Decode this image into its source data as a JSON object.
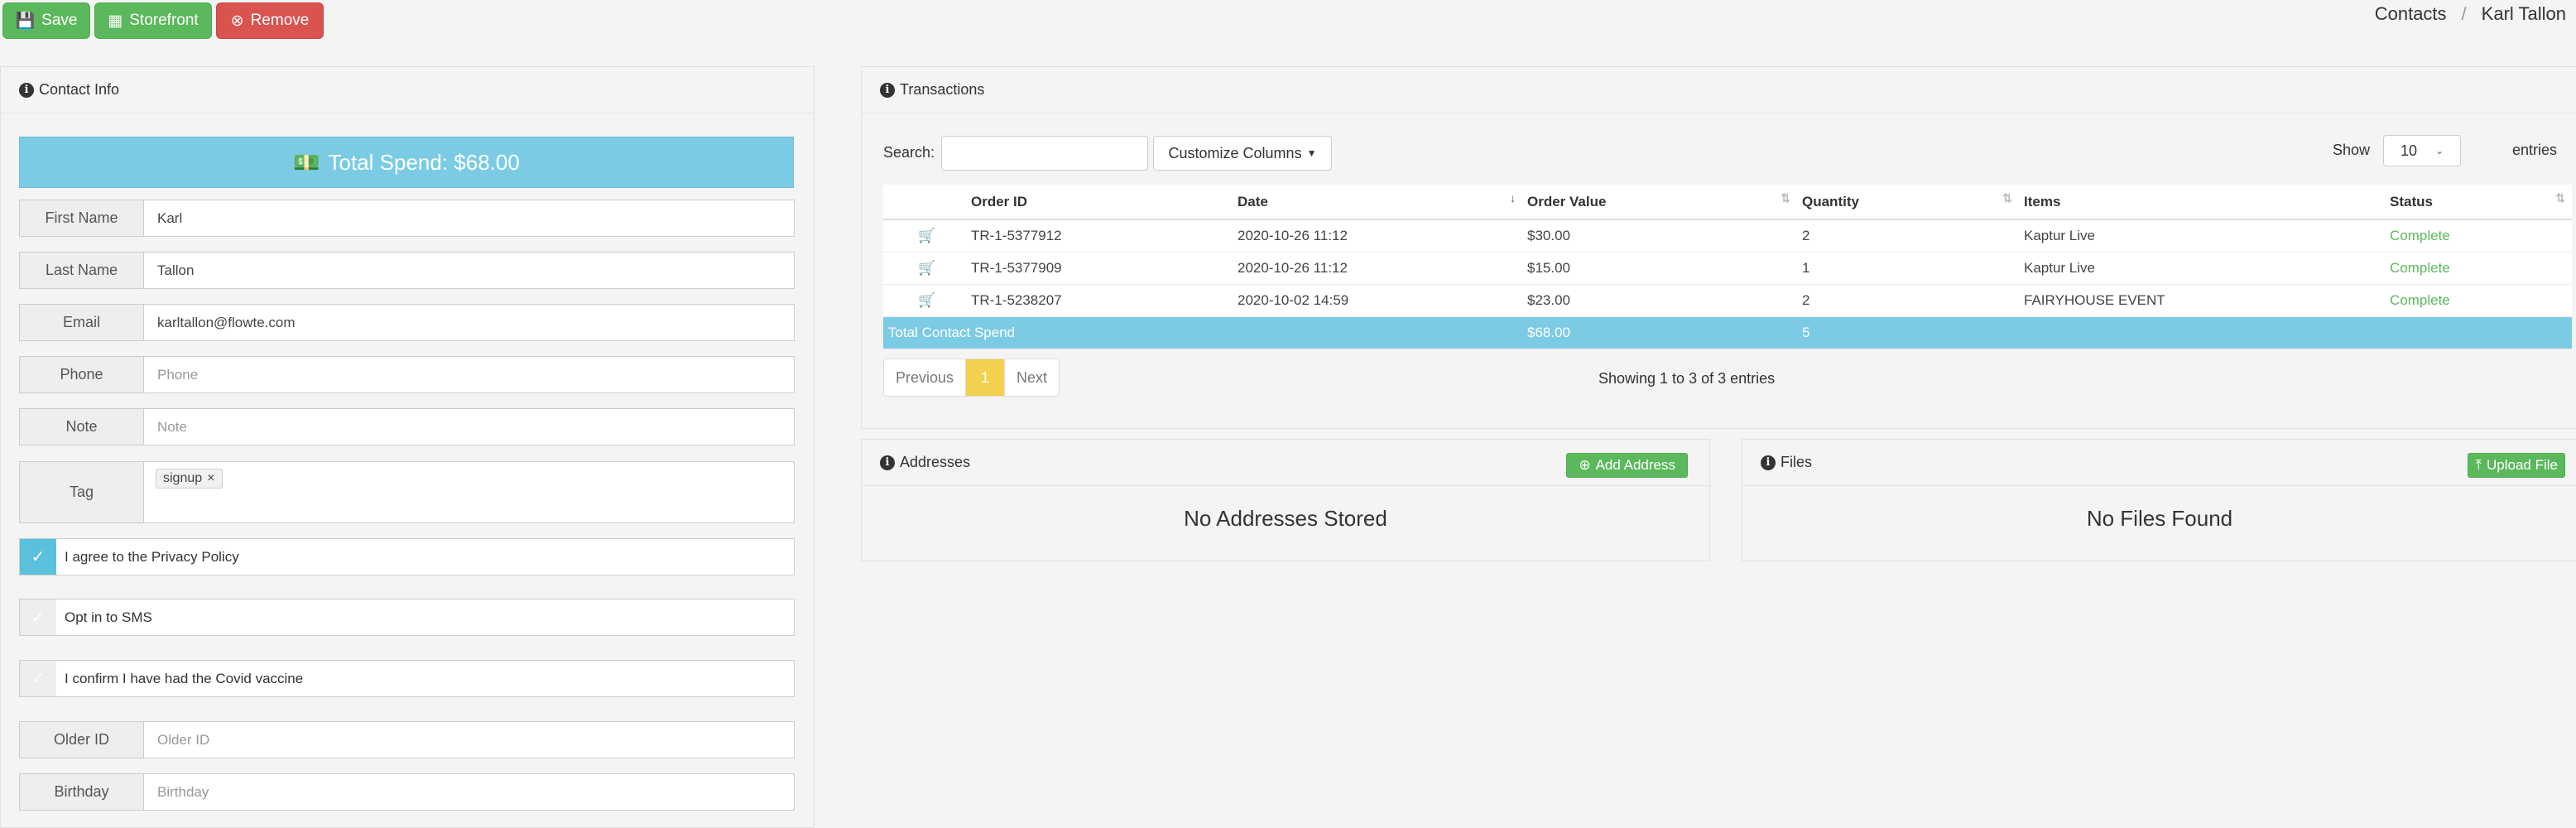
{
  "toolbar": {
    "save": "Save",
    "storefront": "Storefront",
    "remove": "Remove"
  },
  "breadcrumb": {
    "parent": "Contacts",
    "separator": "/",
    "current": "Karl Tallon"
  },
  "contact": {
    "title": "Contact Info",
    "total_spend": "Total Spend: $68.00",
    "fields": {
      "first_name": {
        "label": "First Name",
        "value": "Karl"
      },
      "last_name": {
        "label": "Last Name",
        "value": "Tallon"
      },
      "email": {
        "label": "Email",
        "value": "karltallon@flowte.com"
      },
      "phone": {
        "label": "Phone",
        "placeholder": "Phone"
      },
      "note": {
        "label": "Note",
        "placeholder": "Note"
      },
      "tag": {
        "label": "Tag",
        "chip": "signup",
        "chip_remove": "×"
      },
      "older_id": {
        "label": "Older ID",
        "placeholder": "Older  ID"
      },
      "birthday": {
        "label": "Birthday",
        "placeholder": "Birthday"
      }
    },
    "checks": {
      "privacy": {
        "label": "I agree to the Privacy Policy",
        "checked": true
      },
      "sms": {
        "label": "Opt in to SMS",
        "checked": false
      },
      "covid": {
        "label": "I confirm I have had the Covid vaccine",
        "checked": false
      }
    }
  },
  "transactions": {
    "title": "Transactions",
    "search_label": "Search:",
    "customize_label": "Customize Columns",
    "show_label": "Show",
    "page_size": "10",
    "entries_label": "entries",
    "columns": [
      "Order ID",
      "Date",
      "Order Value",
      "Quantity",
      "Items",
      "Status"
    ],
    "rows": [
      {
        "order_id": "TR-1-5377912",
        "date": "2020-10-26 11:12",
        "value": "$30.00",
        "qty": "2",
        "items": "Kaptur Live",
        "status": "Complete"
      },
      {
        "order_id": "TR-1-5377909",
        "date": "2020-10-26 11:12",
        "value": "$15.00",
        "qty": "1",
        "items": "Kaptur Live",
        "status": "Complete"
      },
      {
        "order_id": "TR-1-5238207",
        "date": "2020-10-02 14:59",
        "value": "$23.00",
        "qty": "2",
        "items": "FAIRYHOUSE EVENT",
        "status": "Complete"
      }
    ],
    "total": {
      "label": "Total Contact Spend",
      "value": "$68.00",
      "qty": "5"
    },
    "pager": {
      "prev": "Previous",
      "current": "1",
      "next": "Next"
    },
    "showing": "Showing 1 to 3 of 3 entries"
  },
  "addresses": {
    "title": "Addresses",
    "add_label": "Add Address",
    "empty": "No Addresses Stored"
  },
  "files": {
    "title": "Files",
    "upload_label": "Upload File",
    "empty": "No Files Found"
  },
  "colors": {
    "green": "#5cb85c",
    "red": "#d9534f",
    "info": "#7ccbe4",
    "page_current": "#f2d14e"
  }
}
